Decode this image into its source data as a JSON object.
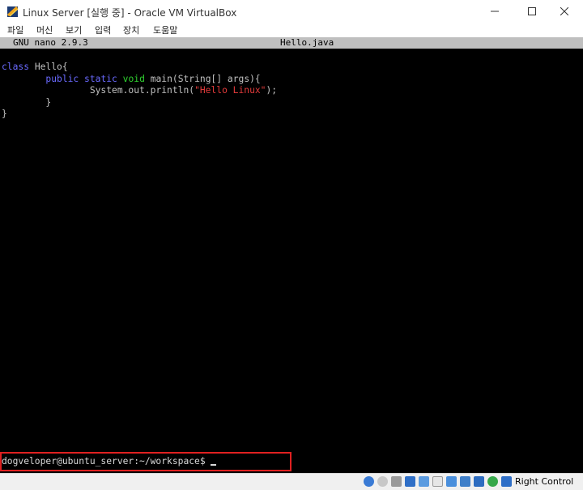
{
  "window": {
    "title": "Linux Server [실행 중] - Oracle VM VirtualBox"
  },
  "menu": [
    {
      "label": "파일"
    },
    {
      "label": "머신"
    },
    {
      "label": "보기"
    },
    {
      "label": "입력"
    },
    {
      "label": "장치"
    },
    {
      "label": "도움말"
    }
  ],
  "nano": {
    "version": "GNU nano 2.9.3",
    "filename": "Hello.java"
  },
  "code": {
    "l1_kw": "class",
    "l1_rest": " Hello{",
    "l2_indent": "        ",
    "l2_kw1": "public",
    "l2_kw2": "static",
    "l2_type": "void",
    "l2_rest": " main(String[] args){",
    "l3_indent": "                ",
    "l3_pre": "System.out.println(",
    "l3_str": "\"Hello Linux\"",
    "l3_post": ");",
    "l4": "        }",
    "l5": "}"
  },
  "prompt": {
    "text": "dogveloper@ubuntu_server:~/workspace$ "
  },
  "status": {
    "host_key": "Right Control"
  },
  "colors": {
    "terminal_bg": "#000000",
    "nano_bar": "#bfbfbf",
    "keyword": "#6a6aff",
    "type": "#2fd22f",
    "string": "#e23a3a",
    "highlight": "#e02020"
  }
}
